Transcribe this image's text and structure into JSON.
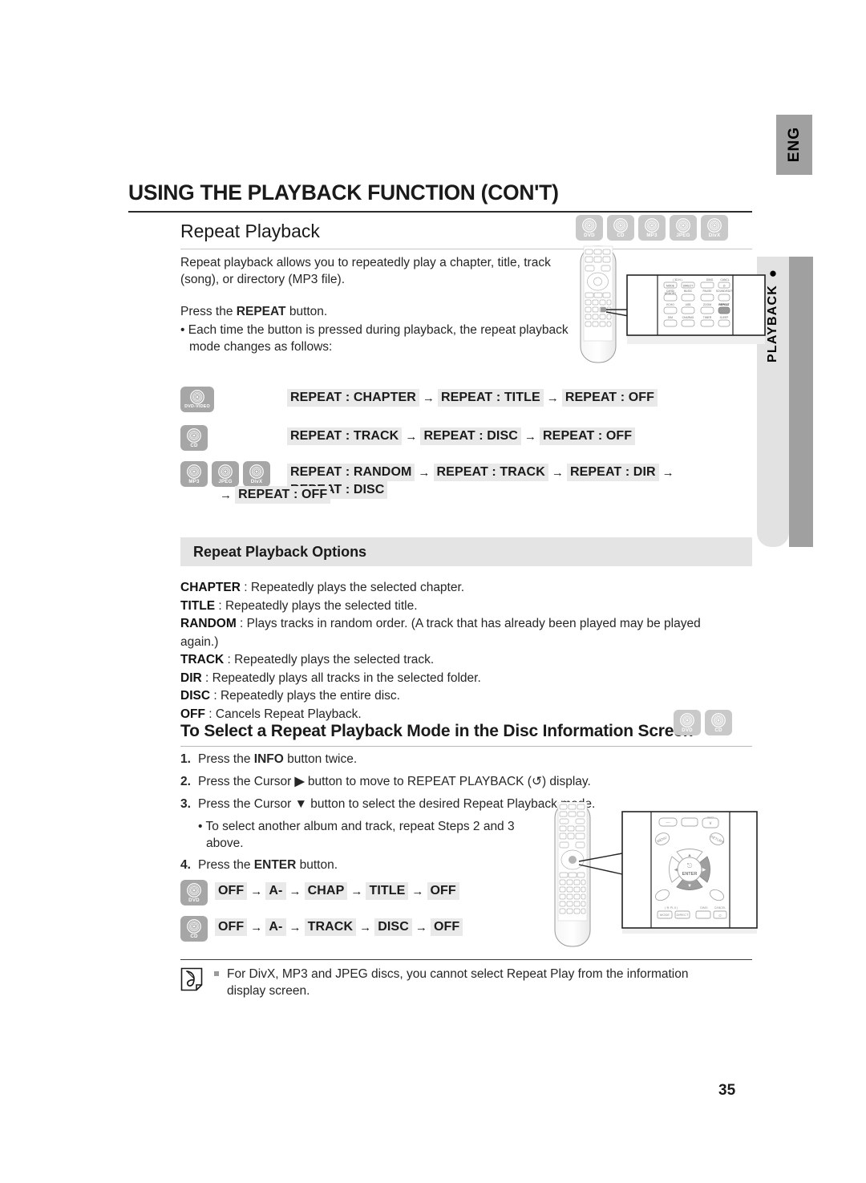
{
  "sidebar": {
    "lang_tab": "ENG",
    "section_tab": "PLAYBACK"
  },
  "page_title": "USING THE PLAYBACK FUNCTION (CON'T)",
  "page_number": "35",
  "section1": {
    "heading": "Repeat Playback",
    "disc_badges": [
      {
        "label": "DVD"
      },
      {
        "label": "CD"
      },
      {
        "label": "MP3"
      },
      {
        "label": "JPEG"
      },
      {
        "label": "DivX"
      }
    ],
    "intro_line1": "Repeat playback allows you to repeatedly play a chapter, title, track",
    "intro_line2": "(song), or directory (MP3 file).",
    "press_prefix": "Press the ",
    "press_button": "REPEAT",
    "press_suffix": " button.",
    "bullet_line1": "Each time the button is pressed during playback, the repeat playback",
    "bullet_line2": "mode changes as follows:"
  },
  "flows": [
    {
      "badges": [
        {
          "label": "DVD-VIDEO",
          "wide": true
        }
      ],
      "items": [
        "REPEAT : CHAPTER",
        "REPEAT : TITLE",
        "REPEAT : OFF"
      ]
    },
    {
      "badges": [
        {
          "label": "CD",
          "wide": false
        }
      ],
      "items": [
        "REPEAT : TRACK",
        "REPEAT : DISC",
        "REPEAT : OFF"
      ]
    },
    {
      "badges": [
        {
          "label": "MP3",
          "wide": false
        },
        {
          "label": "JPEG",
          "wide": false
        },
        {
          "label": "DivX",
          "wide": false
        }
      ],
      "items": [
        "REPEAT : RANDOM",
        "REPEAT : TRACK",
        "REPEAT : DIR",
        "REPEAT : DISC"
      ],
      "wrap_items": [
        "REPEAT : OFF"
      ]
    }
  ],
  "options": {
    "band_title": "Repeat Playback Options",
    "rows": [
      {
        "key": "CHAPTER",
        "text": " : Repeatedly plays the selected chapter."
      },
      {
        "key": "TITLE",
        "text": " : Repeatedly plays the selected title."
      },
      {
        "key": "RANDOM",
        "text": " : Plays tracks in random order. (A track that has already been played may be played again.)"
      },
      {
        "key": "TRACK",
        "text": " : Repeatedly plays the selected track."
      },
      {
        "key": "DIR",
        "text": " : Repeatedly plays all tracks in the selected folder."
      },
      {
        "key": "DISC",
        "text": " : Repeatedly plays the entire disc."
      },
      {
        "key": "OFF",
        "text": " : Cancels Repeat Playback."
      }
    ]
  },
  "section2": {
    "heading": "To Select a Repeat Playback Mode in the Disc Information Screen",
    "disc_badges": [
      {
        "label": "DVD"
      },
      {
        "label": "CD"
      }
    ],
    "steps": [
      {
        "num": "1.",
        "pre": "Press the ",
        "bold": "INFO",
        "post": " button twice."
      },
      {
        "num": "2.",
        "pre": "Press the Cursor ",
        "bold": "▶",
        "post": " button to move to REPEAT PLAYBACK (↺) display."
      },
      {
        "num": "3.",
        "pre": "Press the Cursor ",
        "bold": "▼",
        "post": " button to select the desired Repeat Playback mode."
      }
    ],
    "substep_line1": "To select another album and track, repeat Steps 2 and 3",
    "substep_line2": "above.",
    "step4": {
      "num": "4.",
      "pre": "Press the ",
      "bold": "ENTER",
      "post": " button."
    }
  },
  "flows2": [
    {
      "badges": [
        {
          "label": "DVD",
          "wide": false
        }
      ],
      "items": [
        "OFF",
        "A-",
        "CHAP",
        "TITLE",
        "OFF"
      ]
    },
    {
      "badges": [
        {
          "label": "CD",
          "wide": false
        }
      ],
      "items": [
        "OFF",
        "A-",
        "TRACK",
        "DISC",
        "OFF"
      ]
    }
  ],
  "note": {
    "line1": "For DivX, MP3 and JPEG discs, you cannot select Repeat Play from the information",
    "line2": "display screen."
  },
  "illustrations": {
    "remote_top": {
      "callout_buttons": [
        "MODE",
        "DIRECT",
        "",
        "∅",
        "CARD/\nMEMORY",
        "MUSIC",
        "PAUSE",
        "SOUND/EDIT",
        "ECHO",
        "USB",
        "ZOOM",
        "REPEAT",
        "DIMM",
        "CHARMG",
        "TIMER",
        "SLEEP"
      ],
      "highlighted": "REPEAT",
      "header_label": "( 30 N  )",
      "top_right_labels": [
        "DIMG",
        "CANCL"
      ]
    },
    "remote_bottom": {
      "center_button": "ENTER",
      "left_label": "MENU",
      "right_label": "RETURN",
      "bottom_buttons": [
        "MODE",
        "DIRECT",
        "",
        "∅"
      ],
      "bottom_labels": [
        "( ⓧ PL Ⅱ )",
        "DIMG",
        "CANCEL"
      ],
      "highlighted": [
        "right-arrow",
        "down-arrow"
      ]
    }
  },
  "colors": {
    "tab_dark_gray": "#a0a0a0",
    "tab_light_gray": "#e2e2e2",
    "chip_gray": "#e9e9e9",
    "band_gray": "#e4e4e4",
    "badge_light": "#c9c9c9",
    "badge_dark": "#a6a6a6"
  }
}
